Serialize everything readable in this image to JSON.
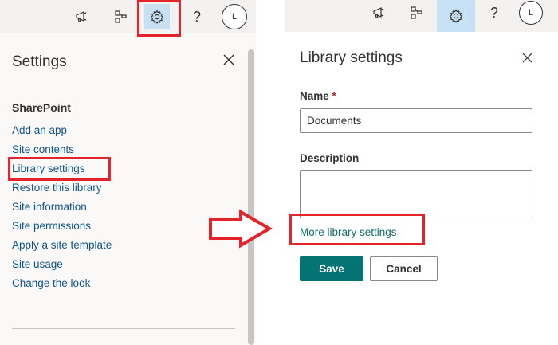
{
  "left_screen": {
    "topbar": {
      "icons": [
        "megaphone-icon",
        "share-icon",
        "gear-icon",
        "help-icon",
        "avatar"
      ],
      "help_glyph": "?",
      "avatar_initial": "L"
    },
    "panel": {
      "title": "Settings",
      "section_heading": "SharePoint",
      "menu_items": [
        "Add an app",
        "Site contents",
        "Library settings",
        "Restore this library",
        "Site information",
        "Site permissions",
        "Apply a site template",
        "Site usage",
        "Change the look"
      ]
    }
  },
  "right_screen": {
    "topbar": {
      "help_glyph": "?",
      "avatar_initial": "L"
    },
    "panel": {
      "title": "Library settings",
      "name_label": "Name",
      "required_marker": "*",
      "name_value": "Documents",
      "description_label": "Description",
      "description_value": "",
      "more_link": "More library settings",
      "save_label": "Save",
      "cancel_label": "Cancel"
    }
  },
  "colors": {
    "accent_teal": "#037373",
    "link_blue": "#0f548c",
    "highlight_red": "#e3242b",
    "selected_icon_bg": "#c7e0f4"
  }
}
